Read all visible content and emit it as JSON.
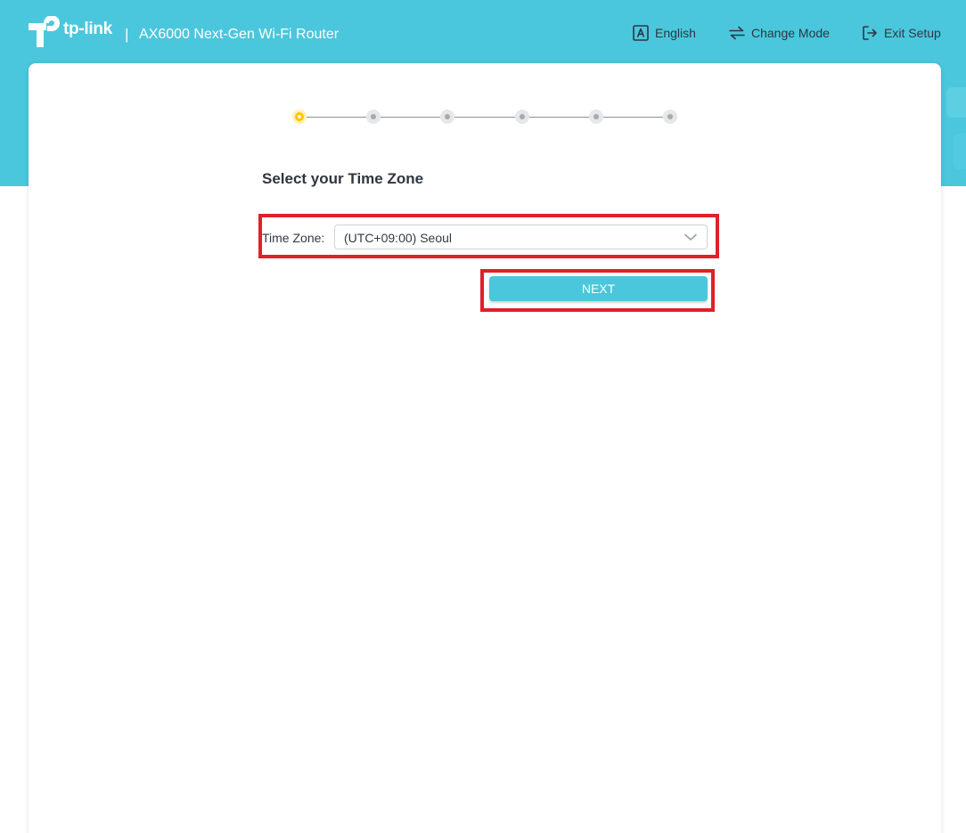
{
  "header": {
    "brand": "tp-link",
    "separator": "|",
    "product": "AX6000 Next-Gen Wi-Fi Router",
    "nav": [
      {
        "label": "English",
        "icon": "language-icon"
      },
      {
        "label": "Change Mode",
        "icon": "swap-arrows-icon"
      },
      {
        "label": "Exit Setup",
        "icon": "exit-icon"
      }
    ]
  },
  "stepper": {
    "total_steps": 6,
    "current_step": 1
  },
  "main": {
    "title": "Select your Time Zone",
    "timezone_label": "Time Zone:",
    "timezone_value": "(UTC+09:00) Seoul",
    "next_label": "NEXT"
  },
  "colors": {
    "header_bg": "#4ac7dc",
    "button_bg": "#4ac7dc",
    "active_step": "#ffc400",
    "highlight_border": "#e0202a"
  }
}
